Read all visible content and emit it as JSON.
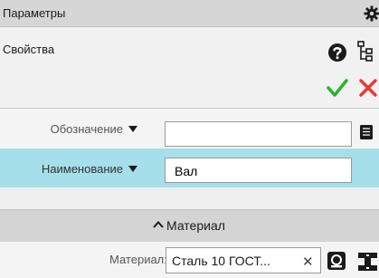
{
  "panel": {
    "title": "Параметры"
  },
  "properties": {
    "label": "Свойства"
  },
  "fields": {
    "designation": {
      "label": "Обозначение",
      "value": ""
    },
    "name": {
      "label": "Наименование",
      "value": "Вал"
    }
  },
  "material_section": {
    "title": "Материал",
    "label": "Материал:",
    "value": "Сталь 10  ГОСТ..."
  },
  "icons": {
    "gear": "gear-icon",
    "help": "help-icon",
    "tree": "tree-structure-icon",
    "ok": "checkmark-icon",
    "cancel": "close-icon",
    "library": "library-icon",
    "database": "database-icon"
  },
  "colors": {
    "ok": "#2bb52b",
    "cancel": "#e53935",
    "highlight_row": "#a5dfe9",
    "titlebar": "#d6d6d6",
    "section": "#d4d4d4"
  }
}
